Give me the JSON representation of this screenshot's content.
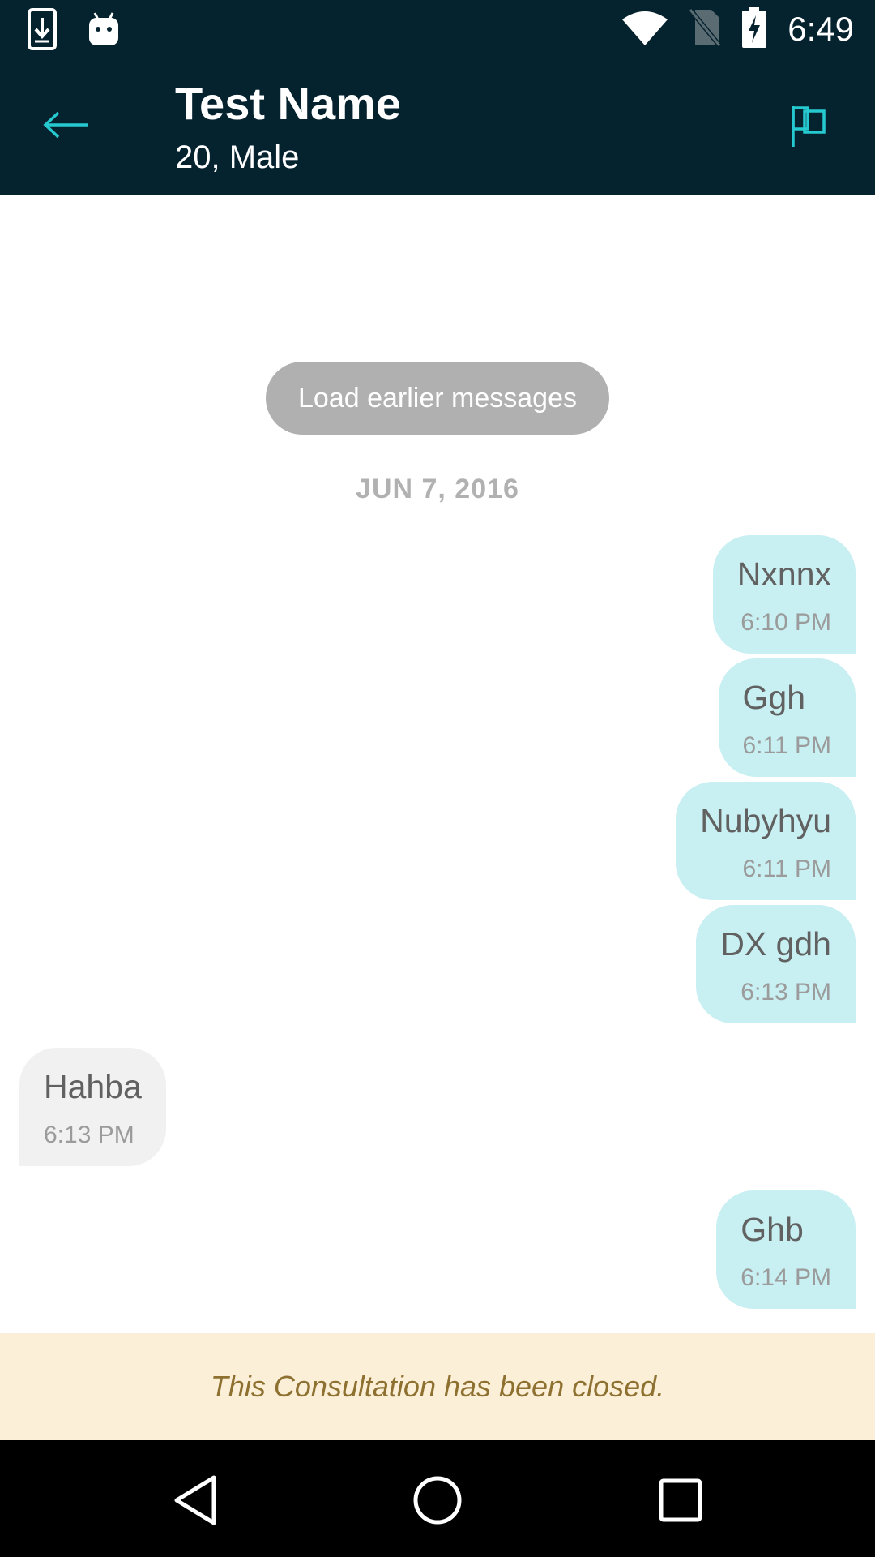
{
  "status_bar": {
    "time": "6:49",
    "left_icons": [
      "download-icon",
      "android-icon"
    ],
    "right_icons": [
      "wifi-icon",
      "no-sim-icon",
      "battery-charging-icon"
    ]
  },
  "header": {
    "title": "Test Name",
    "subtitle": "20, Male",
    "back_icon": "arrow-back-icon",
    "action_icon": "flag-icon"
  },
  "chat": {
    "load_earlier_label": "Load earlier messages",
    "date_separator": "JUN 7, 2016",
    "messages": [
      {
        "direction": "out",
        "text": "Nxnnx",
        "time": "6:10 PM"
      },
      {
        "direction": "out",
        "text": "Ggh",
        "time": "6:11 PM"
      },
      {
        "direction": "out",
        "text": "Nubyhyu",
        "time": "6:11 PM"
      },
      {
        "direction": "out",
        "text": "DX gdh",
        "time": "6:13 PM"
      },
      {
        "direction": "in",
        "text": "Hahba",
        "time": "6:13 PM"
      },
      {
        "direction": "out",
        "text": "Ghb",
        "time": "6:14 PM"
      }
    ]
  },
  "footer": {
    "closed_notice": "This Consultation has been closed."
  },
  "nav_bar": {
    "buttons": [
      "back-triangle-icon",
      "home-circle-icon",
      "recents-square-icon"
    ]
  },
  "colors": {
    "header_bg": "#05222f",
    "accent": "#27c9d0",
    "outgoing_bubble": "#c8eff2",
    "incoming_bubble": "#f1f1f1",
    "banner_bg": "#fbefd7",
    "banner_text": "#8e7131"
  }
}
